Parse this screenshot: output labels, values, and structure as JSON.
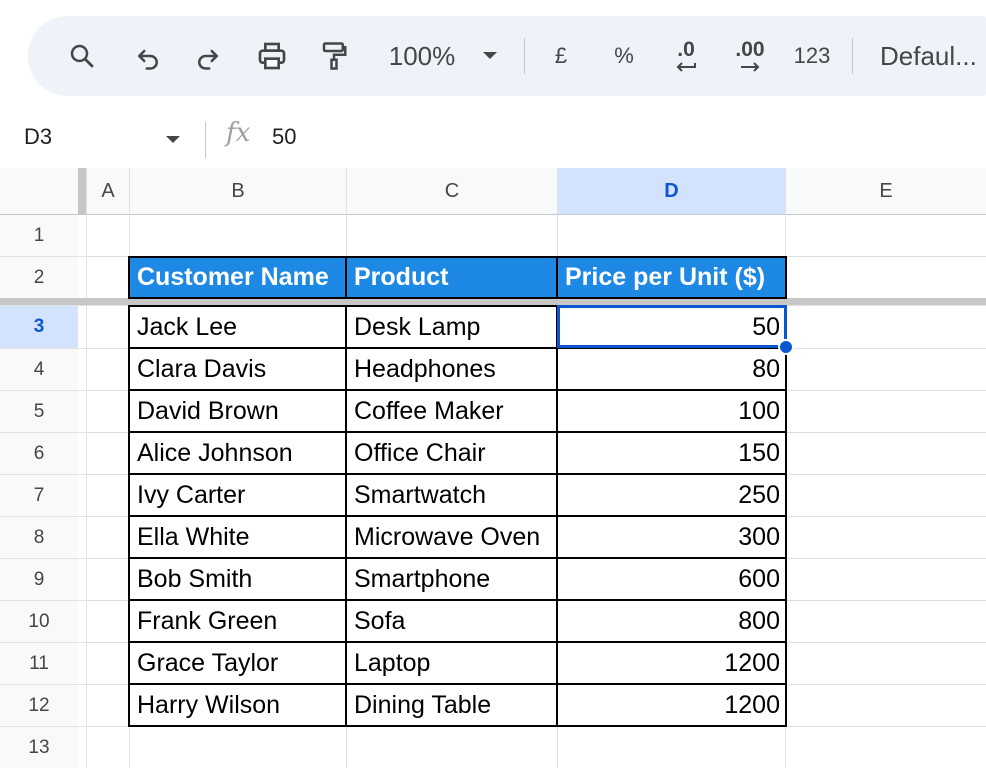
{
  "toolbar": {
    "zoom": "100%",
    "currency_label": "£",
    "percent_label": "%",
    "decrease_decimal_label": ".0",
    "increase_decimal_label": ".00",
    "number_format_label": "123",
    "font_label": "Defaul..."
  },
  "formula_bar": {
    "cell_ref": "D3",
    "fx_label": "fx",
    "value": "50"
  },
  "columns": [
    "A",
    "B",
    "C",
    "D",
    "E"
  ],
  "rows": [
    "1",
    "2",
    "3",
    "4",
    "5",
    "6",
    "7",
    "8",
    "9",
    "10",
    "11",
    "12",
    "13"
  ],
  "table": {
    "headers": [
      "Customer Name",
      "Product",
      "Price per Unit ($)"
    ],
    "rows": [
      [
        "Jack Lee",
        "Desk Lamp",
        "50"
      ],
      [
        "Clara Davis",
        "Headphones",
        "80"
      ],
      [
        "David Brown",
        "Coffee Maker",
        "100"
      ],
      [
        "Alice Johnson",
        "Office Chair",
        "150"
      ],
      [
        "Ivy Carter",
        "Smartwatch",
        "250"
      ],
      [
        "Ella White",
        "Microwave Oven",
        "300"
      ],
      [
        "Bob Smith",
        "Smartphone",
        "600"
      ],
      [
        "Frank Green",
        "Sofa",
        "800"
      ],
      [
        "Grace Taylor",
        "Laptop",
        "1200"
      ],
      [
        "Harry Wilson",
        "Dining Table",
        "1200"
      ]
    ]
  },
  "colors": {
    "header_fill": "#1e88e5",
    "selection": "#0b57d0",
    "active_header": "#d3e3fd"
  }
}
